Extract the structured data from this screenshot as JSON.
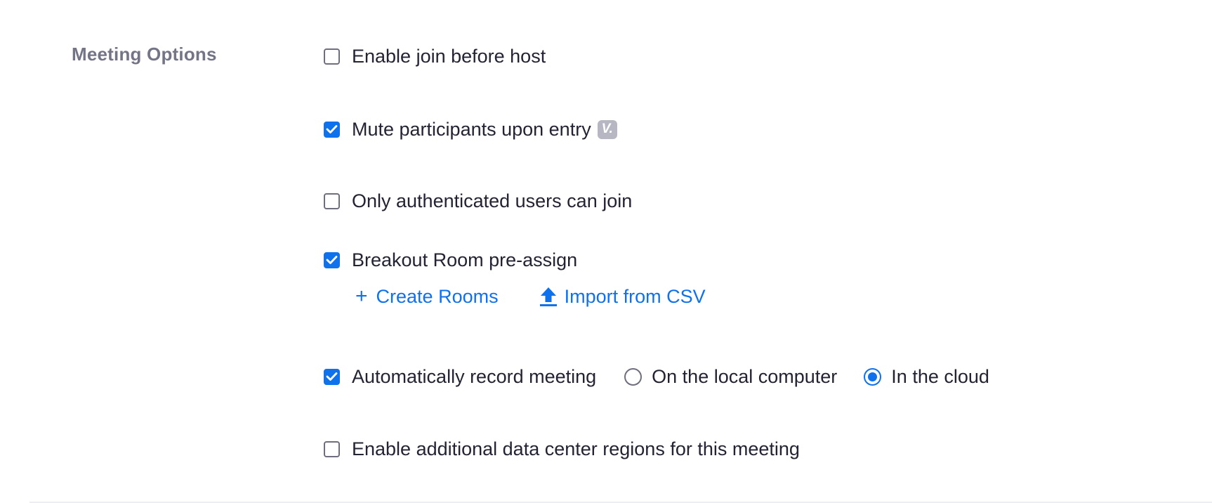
{
  "section": {
    "title": "Meeting Options"
  },
  "options": {
    "join_before_host": {
      "label": "Enable join before host",
      "checked": false
    },
    "mute_on_entry": {
      "label": "Mute participants upon entry",
      "checked": true,
      "badge_icon": "video-badge-icon"
    },
    "authenticated_only": {
      "label": "Only authenticated users can join",
      "checked": false
    },
    "breakout_preassign": {
      "label": "Breakout Room pre-assign",
      "checked": true
    },
    "auto_record": {
      "label": "Automatically record meeting",
      "checked": true
    },
    "data_center_regions": {
      "label": "Enable additional data center regions for this meeting",
      "checked": false
    }
  },
  "breakout_actions": {
    "create_rooms": {
      "label": "Create Rooms",
      "icon": "plus-icon"
    },
    "import_csv": {
      "label": "Import from CSV",
      "icon": "upload-arrow-icon"
    }
  },
  "recording_location": {
    "options": [
      {
        "label": "On the local computer",
        "selected": false
      },
      {
        "label": "In the cloud",
        "selected": true
      }
    ]
  },
  "colors": {
    "accent": "#0e72ed",
    "label_gray": "#747487",
    "text": "#232333",
    "badge": "#b7b7c3"
  }
}
